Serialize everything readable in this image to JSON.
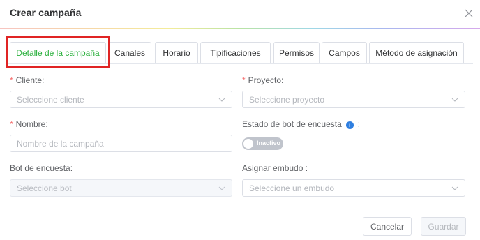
{
  "modal": {
    "title": "Crear campaña"
  },
  "tabs": [
    {
      "label": "Detalle de la campaña",
      "active": true
    },
    {
      "label": "Canales",
      "active": false
    },
    {
      "label": "Horario",
      "active": false
    },
    {
      "label": "Tipificaciones",
      "active": false
    },
    {
      "label": "Permisos",
      "active": false
    },
    {
      "label": "Campos",
      "active": false
    },
    {
      "label": "Método de asignación",
      "active": false
    }
  ],
  "form": {
    "cliente": {
      "required_mark": "*",
      "label": "Cliente",
      "colon": ":",
      "placeholder": "Seleccione cliente"
    },
    "proyecto": {
      "required_mark": "*",
      "label": "Proyecto",
      "colon": ":",
      "placeholder": "Seleccione proyecto"
    },
    "nombre": {
      "required_mark": "*",
      "label": "Nombre",
      "colon": ":",
      "placeholder": "Nombre de la campaña"
    },
    "estado_bot": {
      "label": "Estado de bot de encuesta",
      "colon": ":",
      "toggle_text": "Inactivo",
      "info_icon": "info-icon"
    },
    "bot": {
      "label": "Bot de encuesta",
      "colon": ":",
      "placeholder": "Seleccione bot",
      "disabled": true
    },
    "embudo": {
      "label": "Asignar embudo",
      "colon": ":",
      "placeholder": "Seleccione un embudo"
    }
  },
  "footer": {
    "cancel_label": "Cancelar",
    "save_label": "Guardar"
  },
  "colors": {
    "active_tab": "#2bb03d",
    "required": "#f56c6c",
    "highlight_box": "#e02424",
    "info": "#2f7fe0"
  }
}
